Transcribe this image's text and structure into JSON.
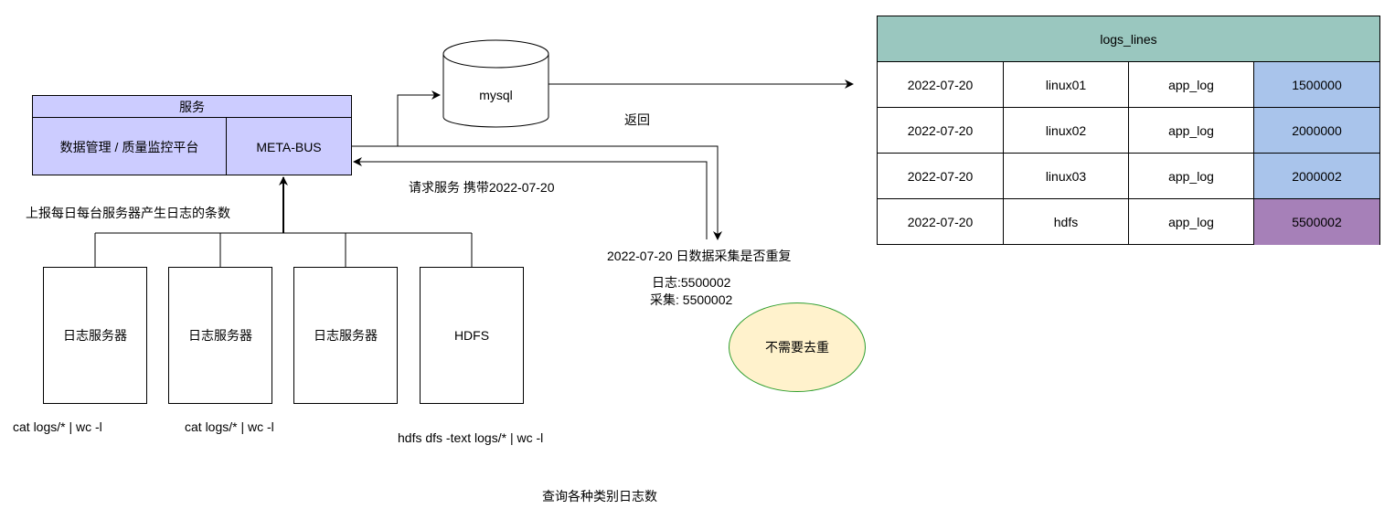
{
  "service": {
    "title": "服务",
    "platform": "数据管理 / 质量监控平台",
    "metabus": "META-BUS"
  },
  "servers": [
    {
      "label": "日志服务器",
      "command": "cat  logs/*  | wc  -l"
    },
    {
      "label": "日志服务器",
      "command": "cat  logs/*  | wc  -l"
    },
    {
      "label": "日志服务器",
      "command": ""
    },
    {
      "label": "HDFS",
      "command": "hdfs  dfs  -text  logs/*  | wc -l"
    }
  ],
  "database": {
    "label": "mysql"
  },
  "labels": {
    "report": "上报每日每台服务器产生日志的条数",
    "request": "请求服务 携带2022-07-20",
    "return": "返回",
    "check": "2022-07-20 日数据采集是否重复",
    "log_count": "日志:5500002",
    "collect_count": "采集: 5500002",
    "query": "查询各种类别日志数"
  },
  "decision": {
    "label": "不需要去重"
  },
  "table": {
    "title": "logs_lines",
    "rows": [
      {
        "date": "2022-07-20",
        "host": "linux01",
        "type": "app_log",
        "count": "1500000",
        "highlight": "blue"
      },
      {
        "date": "2022-07-20",
        "host": "linux02",
        "type": "app_log",
        "count": "2000000",
        "highlight": "blue"
      },
      {
        "date": "2022-07-20",
        "host": "linux03",
        "type": "app_log",
        "count": "2000002",
        "highlight": "blue"
      },
      {
        "date": "2022-07-20",
        "host": "hdfs",
        "type": "app_log",
        "count": "5500002",
        "highlight": "purple"
      }
    ]
  },
  "colors": {
    "service_fill": "#ccccff",
    "table_header": "#9ac7bf",
    "count_blue": "#a9c4eb",
    "count_purple": "#a680b8",
    "ellipse_fill": "#fff2cc",
    "ellipse_stroke": "#2e9e2e"
  }
}
